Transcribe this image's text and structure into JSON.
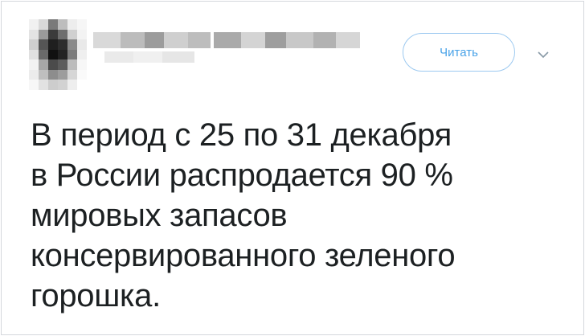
{
  "header": {
    "follow_label": "Читать",
    "avatar_icon": "pixelated-avatar",
    "chevron_icon": "chevron-down-icon"
  },
  "tweet": {
    "lines": [
      "В период с 25 по 31 декабря",
      "в России распродается 90 %",
      "мировых запасов",
      "консервированного зеленого",
      "горошка."
    ]
  },
  "colors": {
    "accent": "#4aa3e8",
    "text": "#1c2022",
    "border": "#d4d8dc"
  }
}
